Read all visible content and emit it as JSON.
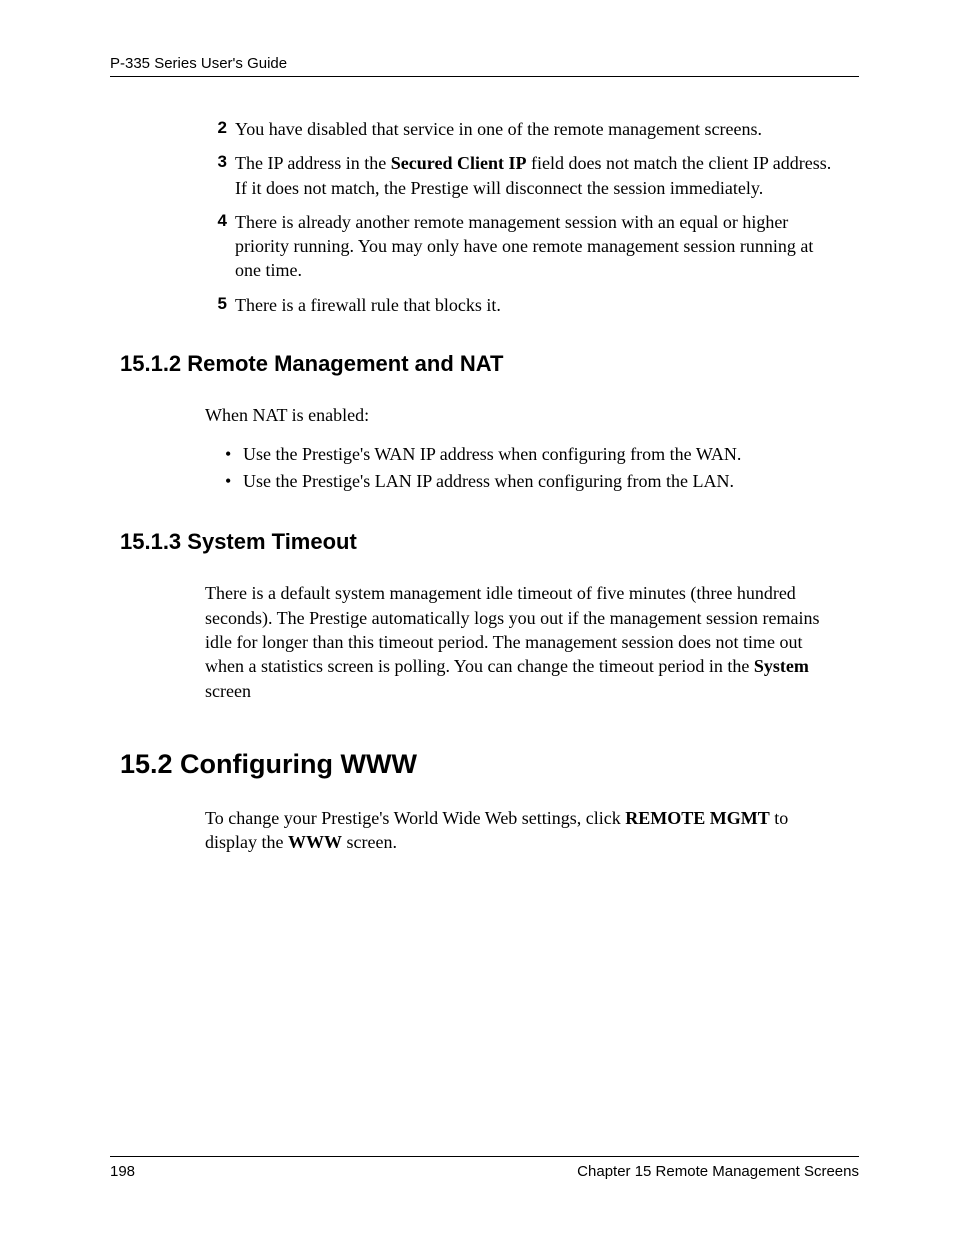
{
  "header": {
    "guide_title": "P-335 Series User's Guide"
  },
  "numbered": [
    {
      "n": "2",
      "segments": [
        {
          "t": "You have disabled that service in one of the remote management screens."
        }
      ]
    },
    {
      "n": "3",
      "segments": [
        {
          "t": "The IP address in the "
        },
        {
          "t": "Secured Client IP",
          "b": true
        },
        {
          "t": " field does not match the client IP address. If it does not match, the Prestige will disconnect the session immediately."
        }
      ]
    },
    {
      "n": "4",
      "segments": [
        {
          "t": "There is already another remote management session with an equal or higher priority running. You may only have one remote management session running at one time."
        }
      ]
    },
    {
      "n": "5",
      "segments": [
        {
          "t": "There is a firewall rule that blocks it."
        }
      ]
    }
  ],
  "sec_15_1_2": {
    "heading": "15.1.2  Remote Management and NAT",
    "intro": "When NAT is enabled:",
    "bullets": [
      "Use the Prestige's WAN IP address when configuring from the WAN.",
      "Use the Prestige's LAN IP address when configuring from the LAN."
    ]
  },
  "sec_15_1_3": {
    "heading": "15.1.3   System Timeout",
    "para_segments": [
      {
        "t": "There is a default system management idle timeout of five minutes (three hundred seconds). The Prestige automatically logs you out if the management session remains idle for longer than this timeout period. The management session does not time out when a statistics screen is polling. You can change the timeout period in the "
      },
      {
        "t": "System",
        "b": true
      },
      {
        "t": " screen"
      }
    ]
  },
  "sec_15_2": {
    "heading": "15.2  Configuring WWW",
    "para_segments": [
      {
        "t": "To change your Prestige's World Wide Web settings, click "
      },
      {
        "t": "REMOTE MGMT",
        "b": true
      },
      {
        "t": " to display the "
      },
      {
        "t": "WWW",
        "b": true
      },
      {
        "t": " screen."
      }
    ]
  },
  "footer": {
    "page_number": "198",
    "chapter": "Chapter 15 Remote Management Screens"
  }
}
